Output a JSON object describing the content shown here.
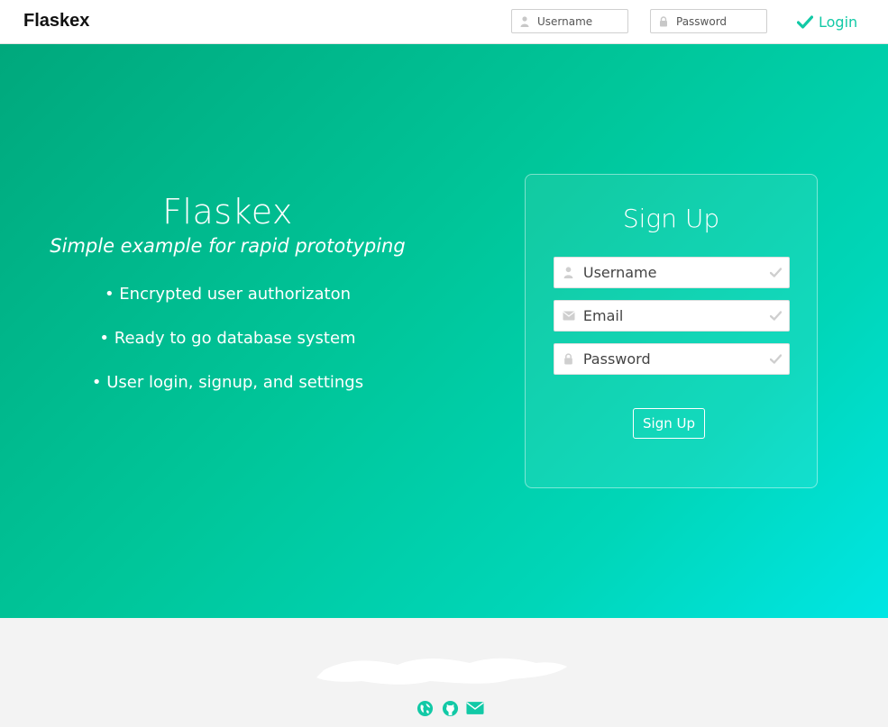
{
  "app": {
    "brand": "Flaskex"
  },
  "nav": {
    "username_placeholder": "Username",
    "password_placeholder": "Password",
    "login_label": "Login",
    "icons": {
      "username": "user-icon",
      "password": "lock-icon",
      "login": "check-icon"
    }
  },
  "hero": {
    "title": "Flaskex",
    "subtitle": "Simple example for rapid prototyping",
    "features": [
      "• Encrypted user authorizaton",
      "• Ready to go database system",
      "• User login, signup, and settings"
    ]
  },
  "signup": {
    "title": "Sign Up",
    "fields": [
      {
        "placeholder": "Username",
        "icon": "user-icon"
      },
      {
        "placeholder": "Email",
        "icon": "envelope-icon"
      },
      {
        "placeholder": "Password",
        "icon": "lock-icon"
      }
    ],
    "button_label": "Sign Up"
  },
  "footer": {
    "icons": [
      "globe-icon",
      "github-icon",
      "envelope-icon"
    ]
  },
  "colors": {
    "accent": "#12c9a6",
    "hero_gradient_start": "#00a87c",
    "hero_gradient_end": "#00e6e4",
    "footer_bg": "#f3f3f3"
  }
}
